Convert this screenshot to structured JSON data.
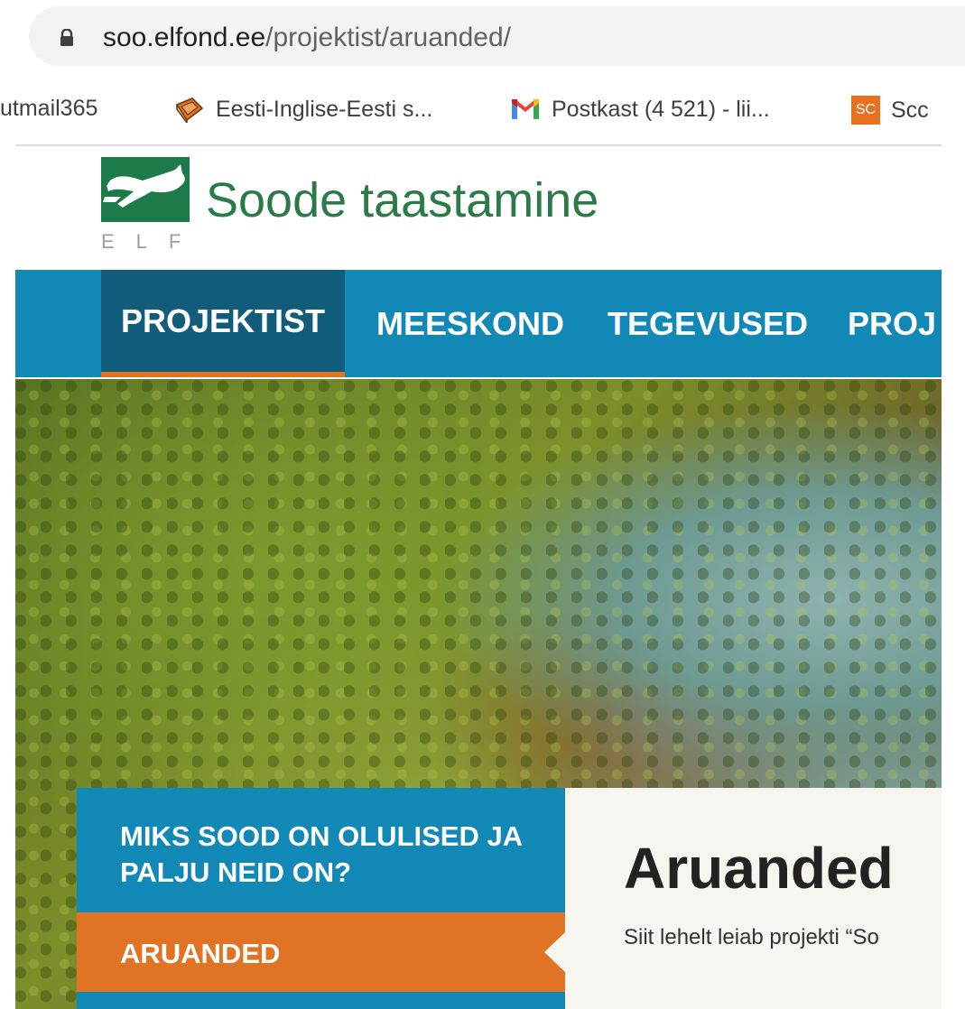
{
  "browser": {
    "url_domain": "soo.elfond.ee",
    "url_path": "/projektist/aruanded/",
    "bookmarks": [
      {
        "label": "utmail365",
        "icon": ""
      },
      {
        "label": "Eesti-Inglise-Eesti s...",
        "icon": "book-icon"
      },
      {
        "label": "Postkast (4 521) - lii...",
        "icon": "gmail-icon"
      },
      {
        "label": "Scc",
        "icon": "sc-icon",
        "icon_text": "SC"
      }
    ]
  },
  "site": {
    "logo_letters": "ELF",
    "title": "Soode taastamine",
    "brand_color": "#1d7b4a"
  },
  "nav": {
    "items": [
      "PROJEKTIST",
      "MEESKOND",
      "TEGEVUSED",
      "PROJ"
    ],
    "active_index": 0,
    "bg_color": "#1288b6",
    "active_color": "#105c7a",
    "accent_color": "#e07424"
  },
  "side_menu": {
    "items": [
      {
        "label": "MIKS SOOD ON OLULISED JA PALJU NEID ON?"
      },
      {
        "label": "ARUANDED"
      }
    ]
  },
  "content": {
    "heading": "Aruanded",
    "intro": "Siit lehelt leiab projekti “So"
  }
}
